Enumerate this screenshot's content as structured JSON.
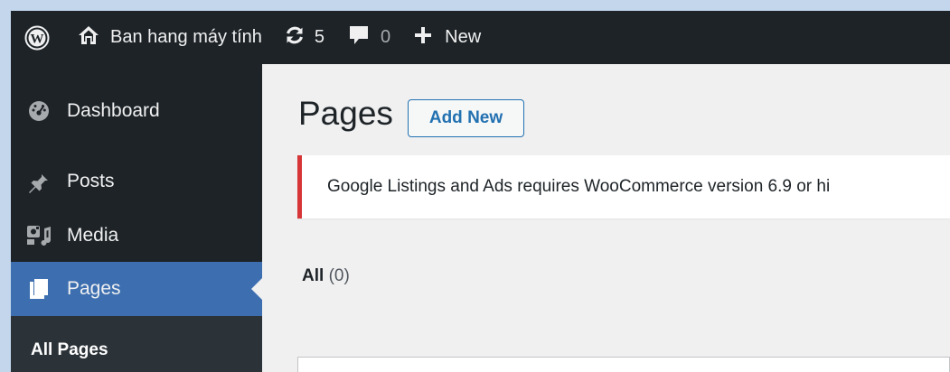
{
  "adminbar": {
    "logo_icon": "wordpress-icon",
    "site_icon": "home-icon",
    "site_name": "Ban hang máy tính",
    "updates_icon": "updates-icon",
    "updates_count": "5",
    "comments_icon": "comment-icon",
    "comments_count": "0",
    "new_icon": "plus-icon",
    "new_label": "New"
  },
  "sidebar": {
    "items": [
      {
        "label": "Dashboard",
        "icon": "dashboard-icon"
      },
      {
        "label": "Posts",
        "icon": "pin-icon"
      },
      {
        "label": "Media",
        "icon": "media-icon"
      },
      {
        "label": "Pages",
        "icon": "pages-icon",
        "active": true
      }
    ],
    "submenu": [
      {
        "label": "All Pages",
        "current": true
      }
    ]
  },
  "main": {
    "title": "Pages",
    "add_new_label": "Add New",
    "notice": "Google Listings and Ads requires WooCommerce version 6.9 or hi",
    "filter_all_label": "All",
    "filter_all_count": "(0)"
  },
  "colors": {
    "adminbar_bg": "#1d2327",
    "menu_active": "#3d6fb0",
    "accent": "#2271b1",
    "notice_error": "#d63638",
    "content_bg": "#f0f0f1"
  }
}
